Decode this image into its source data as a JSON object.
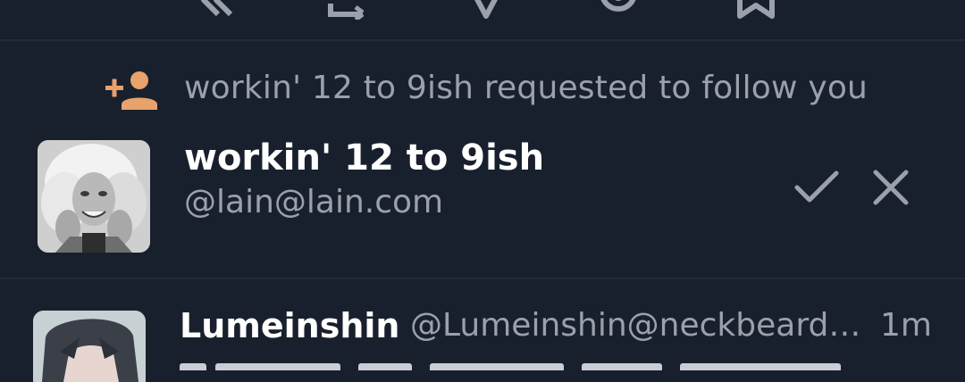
{
  "colors": {
    "background": "#19202d",
    "divider": "#232b39",
    "accent": "#e8a26b",
    "muted_text": "#9aa1ad",
    "primary_text": "#ffffff",
    "icon_muted": "#9aa1ad"
  },
  "action_bar": {
    "icons": [
      "reply-all-icon",
      "boost-icon",
      "favorite-star-icon",
      "emoji-reaction-icon",
      "bookmark-icon"
    ]
  },
  "notification": {
    "icon": "follow-request-icon",
    "text": "workin' 12 to 9ish requested to follow you"
  },
  "follow_request": {
    "display_name": "workin' 12 to 9ish",
    "handle": "@lain@lain.com",
    "accept_icon": "check-icon",
    "reject_icon": "close-icon"
  },
  "next_status": {
    "display_name": "Lumeinshin",
    "handle": "@Lumeinshin@neckbeard…",
    "time": "1m"
  }
}
